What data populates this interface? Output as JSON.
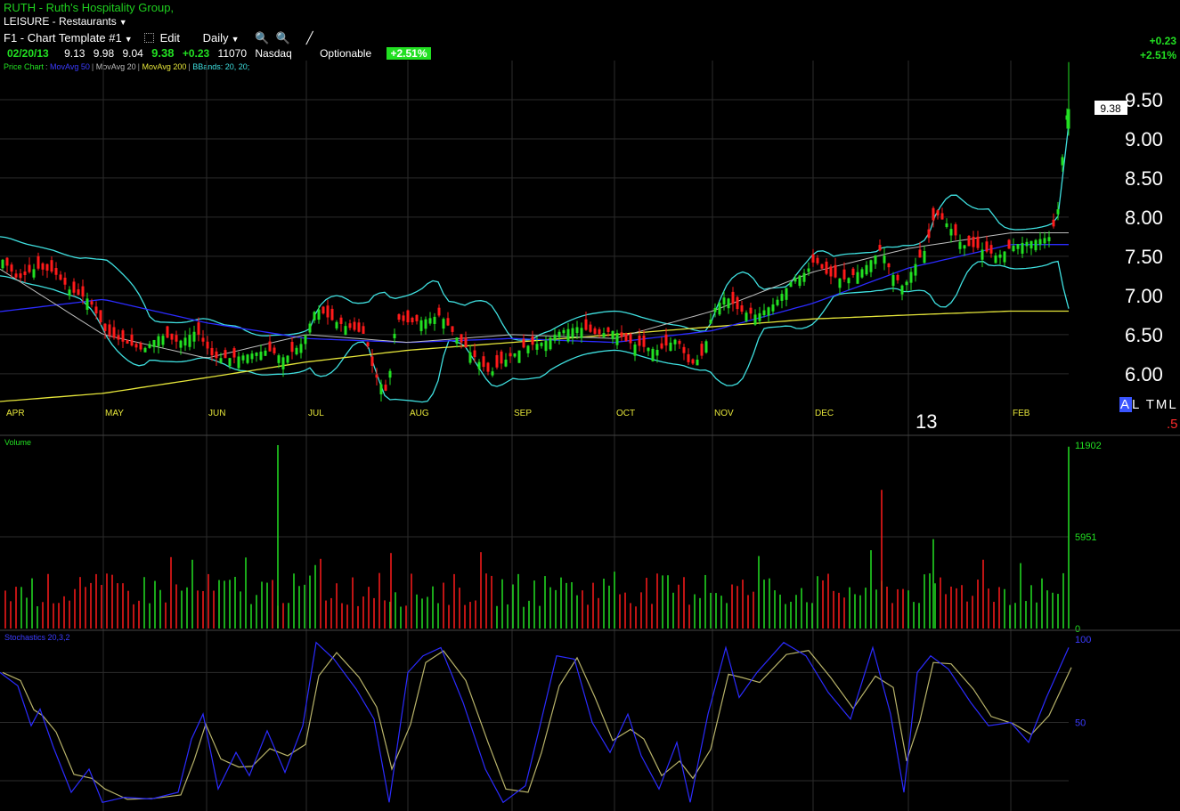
{
  "header": {
    "title": "RUTH - Ruth's Hospitality Group,",
    "industry": "LEISURE - Restaurants",
    "template": "F1 - Chart Template #1",
    "edit_label": "Edit",
    "period_label": "Daily"
  },
  "quote": {
    "date": "02/20/13",
    "open": "9.13",
    "high": "9.98",
    "low": "9.04",
    "close": "9.38",
    "change": "+0.23",
    "volume": "11070",
    "exchange": "Nasdaq",
    "optionable": "Optionable",
    "pct_change": "+2.51%"
  },
  "top_right": {
    "change": "+0.23",
    "pct": "+2.51%"
  },
  "legend": {
    "price_chart": "Price Chart",
    "ma50": "MovAvg 50",
    "ma20": "MovAvg 20",
    "ma200": "MovAvg 200",
    "bbands": "BBands: 20, 20;"
  },
  "bottom_right": {
    "al_a": "A",
    "al_rest": "L TML",
    "red_label": ".5"
  },
  "colors": {
    "up": "#22e022",
    "down": "#ff1a1a",
    "bbands": "#3fe0e0",
    "ma20": "#bdbdbd",
    "ma50": "#2b2bff",
    "ma200": "#e6e63a",
    "grid": "#2b2b2b"
  },
  "chart_data": [
    {
      "type": "candlestick",
      "title": "Price Chart",
      "x_labels": [
        "APR",
        "MAY",
        "JUN",
        "JUL",
        "AUG",
        "SEP",
        "OCT",
        "NOV",
        "DEC",
        "13",
        "FEB"
      ],
      "y_ticks": [
        "9.50",
        "9.00",
        "8.50",
        "8.00",
        "7.50",
        "7.00",
        "6.50",
        "6.00"
      ],
      "ylim": [
        5.6,
        10.0
      ],
      "last_price_label": "9.38",
      "series": [
        {
          "name": "MovAvg 20",
          "values_by_month": [
            7.3,
            6.5,
            6.2,
            6.5,
            6.4,
            6.5,
            6.45,
            6.8,
            7.3,
            7.6,
            7.8
          ]
        },
        {
          "name": "MovAvg 50",
          "values_by_month": [
            6.8,
            6.95,
            6.65,
            6.45,
            6.4,
            6.45,
            6.4,
            6.55,
            6.9,
            7.35,
            7.65
          ]
        },
        {
          "name": "MovAvg 200",
          "values_by_month": [
            5.65,
            5.75,
            5.95,
            6.15,
            6.3,
            6.4,
            6.5,
            6.6,
            6.7,
            6.75,
            6.8
          ]
        }
      ],
      "anchors": [
        [
          0,
          7.5
        ],
        [
          20,
          7.2
        ],
        [
          40,
          7.35
        ],
        [
          60,
          7.3
        ],
        [
          80,
          7.05
        ],
        [
          100,
          6.95
        ],
        [
          120,
          6.5
        ],
        [
          140,
          6.4
        ],
        [
          160,
          6.3
        ],
        [
          180,
          6.5
        ],
        [
          200,
          6.4
        ],
        [
          220,
          6.55
        ],
        [
          240,
          6.2
        ],
        [
          260,
          6.2
        ],
        [
          280,
          6.25
        ],
        [
          300,
          6.3
        ],
        [
          320,
          6.2
        ],
        [
          340,
          6.4
        ],
        [
          355,
          6.85
        ],
        [
          370,
          6.7
        ],
        [
          390,
          6.6
        ],
        [
          410,
          6.5
        ],
        [
          420,
          6.0
        ],
        [
          435,
          5.75
        ],
        [
          445,
          6.7
        ],
        [
          460,
          6.65
        ],
        [
          480,
          6.7
        ],
        [
          495,
          6.75
        ],
        [
          510,
          6.5
        ],
        [
          530,
          6.25
        ],
        [
          550,
          6.0
        ],
        [
          570,
          6.2
        ],
        [
          590,
          6.35
        ],
        [
          610,
          6.4
        ],
        [
          630,
          6.55
        ],
        [
          650,
          6.6
        ],
        [
          670,
          6.5
        ],
        [
          690,
          6.55
        ],
        [
          705,
          6.4
        ],
        [
          720,
          6.35
        ],
        [
          740,
          6.3
        ],
        [
          760,
          6.45
        ],
        [
          775,
          6.1
        ],
        [
          790,
          6.25
        ],
        [
          800,
          6.8
        ],
        [
          815,
          7.0
        ],
        [
          830,
          6.8
        ],
        [
          850,
          6.75
        ],
        [
          870,
          6.9
        ],
        [
          890,
          7.2
        ],
        [
          905,
          7.3
        ],
        [
          915,
          7.45
        ],
        [
          930,
          7.25
        ],
        [
          950,
          7.2
        ],
        [
          970,
          7.35
        ],
        [
          990,
          7.6
        ],
        [
          1000,
          7.3
        ],
        [
          1015,
          7.1
        ],
        [
          1025,
          7.35
        ],
        [
          1040,
          7.6
        ],
        [
          1050,
          8.05
        ],
        [
          1065,
          7.9
        ],
        [
          1080,
          7.65
        ],
        [
          1100,
          7.6
        ],
        [
          1120,
          7.5
        ],
        [
          1140,
          7.65
        ],
        [
          1160,
          7.7
        ],
        [
          1180,
          7.75
        ],
        [
          1188,
          8.1
        ],
        [
          1194,
          8.9
        ],
        [
          1199,
          9.4
        ]
      ]
    },
    {
      "type": "bar",
      "title": "Volume",
      "y_ticks": [
        "11902",
        "5951",
        "0"
      ],
      "ylim": [
        0,
        11902
      ],
      "spikes": [
        [
          312,
          11902,
          "up"
        ],
        [
          439,
          4900,
          "down"
        ],
        [
          990,
          9000,
          "down"
        ],
        [
          1048,
          5800,
          "up"
        ],
        [
          1200,
          11800,
          "up"
        ]
      ]
    },
    {
      "type": "line",
      "title": "Stochastics 20,3,2",
      "y_ticks": [
        "100",
        "50"
      ],
      "ylim": [
        0,
        100
      ],
      "values": [
        [
          0,
          80
        ],
        [
          20,
          72
        ],
        [
          35,
          48
        ],
        [
          45,
          58
        ],
        [
          60,
          35
        ],
        [
          80,
          8
        ],
        [
          100,
          22
        ],
        [
          115,
          2
        ],
        [
          140,
          5
        ],
        [
          170,
          4
        ],
        [
          200,
          8
        ],
        [
          215,
          40
        ],
        [
          228,
          55
        ],
        [
          245,
          10
        ],
        [
          265,
          32
        ],
        [
          280,
          18
        ],
        [
          300,
          45
        ],
        [
          320,
          20
        ],
        [
          340,
          48
        ],
        [
          355,
          98
        ],
        [
          375,
          88
        ],
        [
          400,
          70
        ],
        [
          420,
          52
        ],
        [
          437,
          2
        ],
        [
          458,
          80
        ],
        [
          475,
          90
        ],
        [
          495,
          95
        ],
        [
          520,
          62
        ],
        [
          545,
          22
        ],
        [
          565,
          2
        ],
        [
          590,
          12
        ],
        [
          605,
          45
        ],
        [
          625,
          90
        ],
        [
          645,
          88
        ],
        [
          665,
          50
        ],
        [
          685,
          32
        ],
        [
          705,
          55
        ],
        [
          720,
          30
        ],
        [
          740,
          10
        ],
        [
          760,
          38
        ],
        [
          775,
          2
        ],
        [
          795,
          55
        ],
        [
          815,
          95
        ],
        [
          830,
          65
        ],
        [
          850,
          80
        ],
        [
          880,
          98
        ],
        [
          905,
          90
        ],
        [
          930,
          68
        ],
        [
          955,
          52
        ],
        [
          980,
          95
        ],
        [
          1000,
          55
        ],
        [
          1015,
          8
        ],
        [
          1030,
          80
        ],
        [
          1045,
          90
        ],
        [
          1065,
          82
        ],
        [
          1090,
          62
        ],
        [
          1110,
          48
        ],
        [
          1135,
          50
        ],
        [
          1155,
          38
        ],
        [
          1175,
          65
        ],
        [
          1200,
          95
        ]
      ]
    }
  ]
}
